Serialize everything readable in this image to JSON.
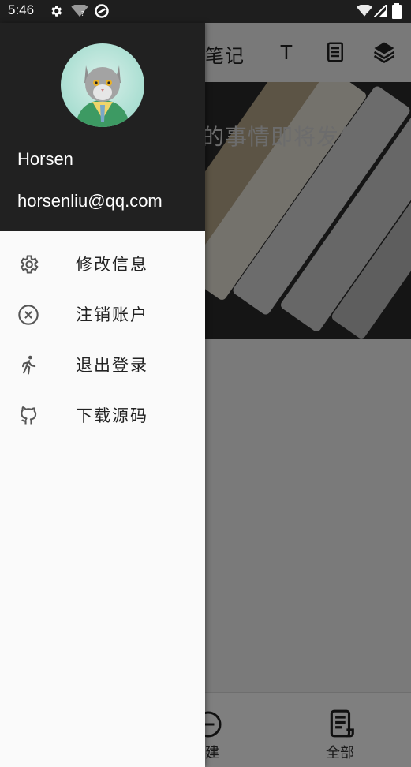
{
  "status_bar": {
    "time": "5:46"
  },
  "app": {
    "toolbar_title": "笔记",
    "toolbar_text_button": "T",
    "hero_text": "的事情即将发生。",
    "bottom_nav": {
      "new_label": "建",
      "all_label": "全部"
    }
  },
  "drawer": {
    "user_name": "Horsen",
    "user_email": "horsenliu@qq.com",
    "menu": [
      {
        "label": "修改信息",
        "icon": "settings-icon"
      },
      {
        "label": "注销账户",
        "icon": "cancel-icon"
      },
      {
        "label": "退出登录",
        "icon": "running-person-icon"
      },
      {
        "label": "下载源码",
        "icon": "github-icon"
      }
    ]
  }
}
